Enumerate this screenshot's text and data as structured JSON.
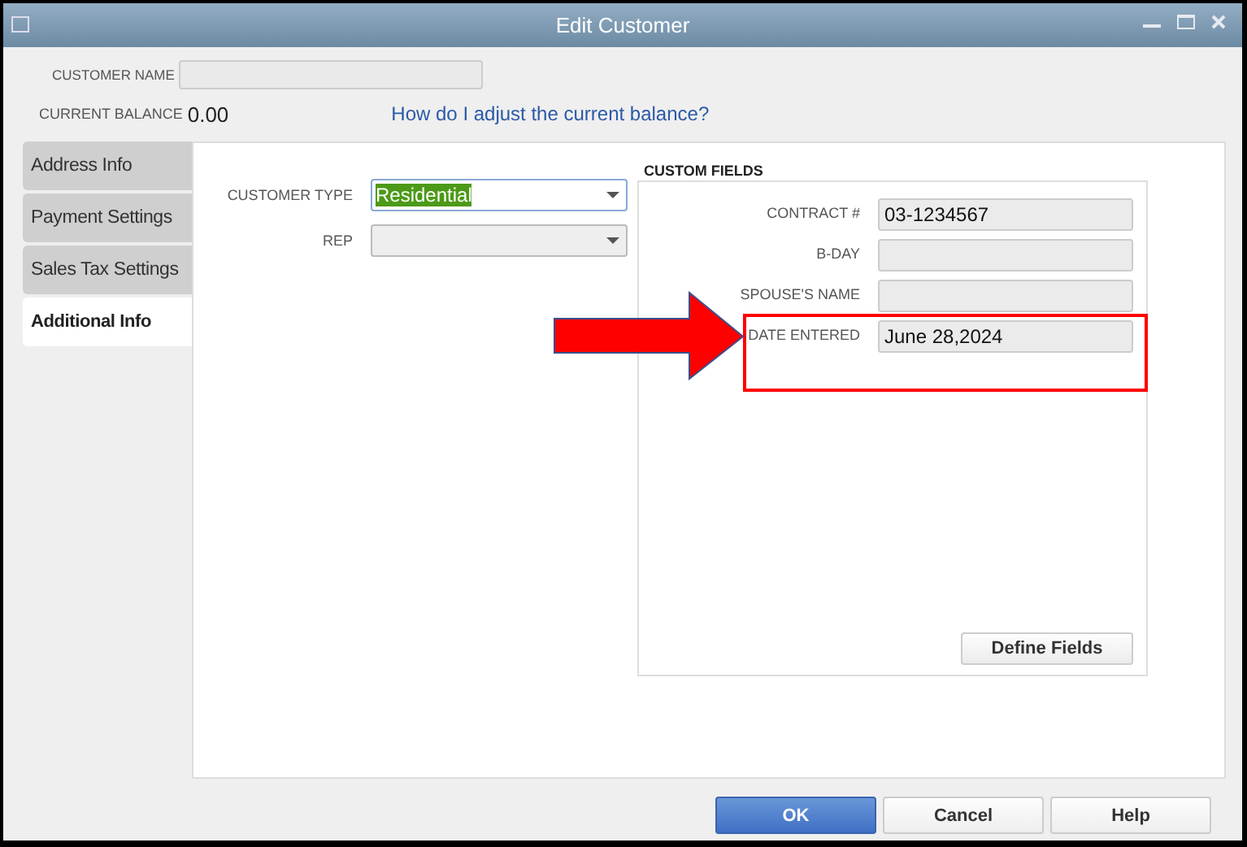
{
  "window": {
    "title": "Edit Customer"
  },
  "header": {
    "customer_name": {
      "label": "CUSTOMER NAME"
    },
    "balance": {
      "label": "CURRENT BALANCE",
      "value": "0.00"
    },
    "link": "How do I adjust the current balance?"
  },
  "tabs": [
    {
      "label": "Address Info",
      "selected": false
    },
    {
      "label": "Payment Settings",
      "selected": false
    },
    {
      "label": "Sales Tax Settings",
      "selected": false
    },
    {
      "label": "Additional Info",
      "selected": true
    }
  ],
  "fields": [
    {
      "label": "CUSTOMER TYPE",
      "value": "Residential",
      "highlighted": true
    },
    {
      "label": "REP",
      "highlighted": false
    }
  ],
  "custom_fields": {
    "title": "CUSTOM FIELDS",
    "rows": [
      {
        "label": "CONTRACT #",
        "value": "03-1234567",
        "highlighted": false
      },
      {
        "label": "B-DAY",
        "highlighted": false
      },
      {
        "label": "SPOUSE'S NAME",
        "highlighted": false
      },
      {
        "label": "DATE ENTERED",
        "value": "June 28,2024",
        "highlighted": true
      }
    ],
    "button": "Define Fields"
  },
  "buttons": [
    {
      "label": "OK",
      "kind": "primary"
    },
    {
      "label": "Cancel",
      "kind": "normal"
    },
    {
      "label": "Help",
      "kind": "normal"
    }
  ]
}
